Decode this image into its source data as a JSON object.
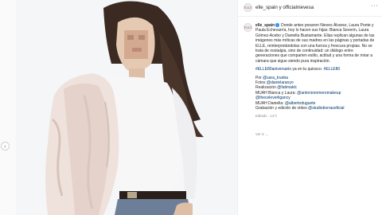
{
  "post": {
    "header_title": "elle_spain y officialnievesa",
    "avatar_text": "ELLE",
    "more_icon": "more-horizontal-icon"
  },
  "caption": {
    "user": "elle_spain",
    "line1": "Donde antes posaron Nieves Álvarez, Laura Ponte y",
    "line2": "Paula Echevarría, hoy lo hacen sus hijas: Bianca Severin, Laura",
    "line3": "Gómez-Acebo y Daniella Bustamante. Ellas replican algunas de las",
    "line4": "imágenes más míticas de sus madres en las páginas y portadas de",
    "line5": "ELLE, reinterpretándolas con una fuerza y frescura propias. No se",
    "line6": "trata de nostalgia, sino de continuidad: un diálogo entre",
    "line7": "generaciones que comparten estilo, actitud y una forma de mirar a",
    "line8": "cámara que sigue siendo pura inspiración.",
    "hashtag1": "#ELLE80aniversario",
    "hashtag_mid": " ya en tu quiosco. ",
    "hashtag2": "#ELLE80",
    "credits": [
      {
        "label": "Por ",
        "handle": "@sara_trueba"
      },
      {
        "label": "Fotos ",
        "handle": "@danielaranyo"
      },
      {
        "label": "Realización ",
        "handle": "@fatimaklc"
      },
      {
        "label": "MUAH Bianca y Laura: ",
        "handle": "@antonioromeromakeup"
      },
      {
        "label": "",
        "handle": "@theceleverligancy"
      },
      {
        "label": "MUAH Daniella: ",
        "handle": "@albertoduguete"
      },
      {
        "label": "Grabación y edición de vídeo ",
        "handle": "@studioborrasoficial"
      }
    ],
    "timestamp": "Editado · 14 h"
  },
  "reply": {
    "label": "Ver 6"
  },
  "nav": {
    "prev_icon": "chevron-left-icon",
    "prev_glyph": "‹"
  }
}
